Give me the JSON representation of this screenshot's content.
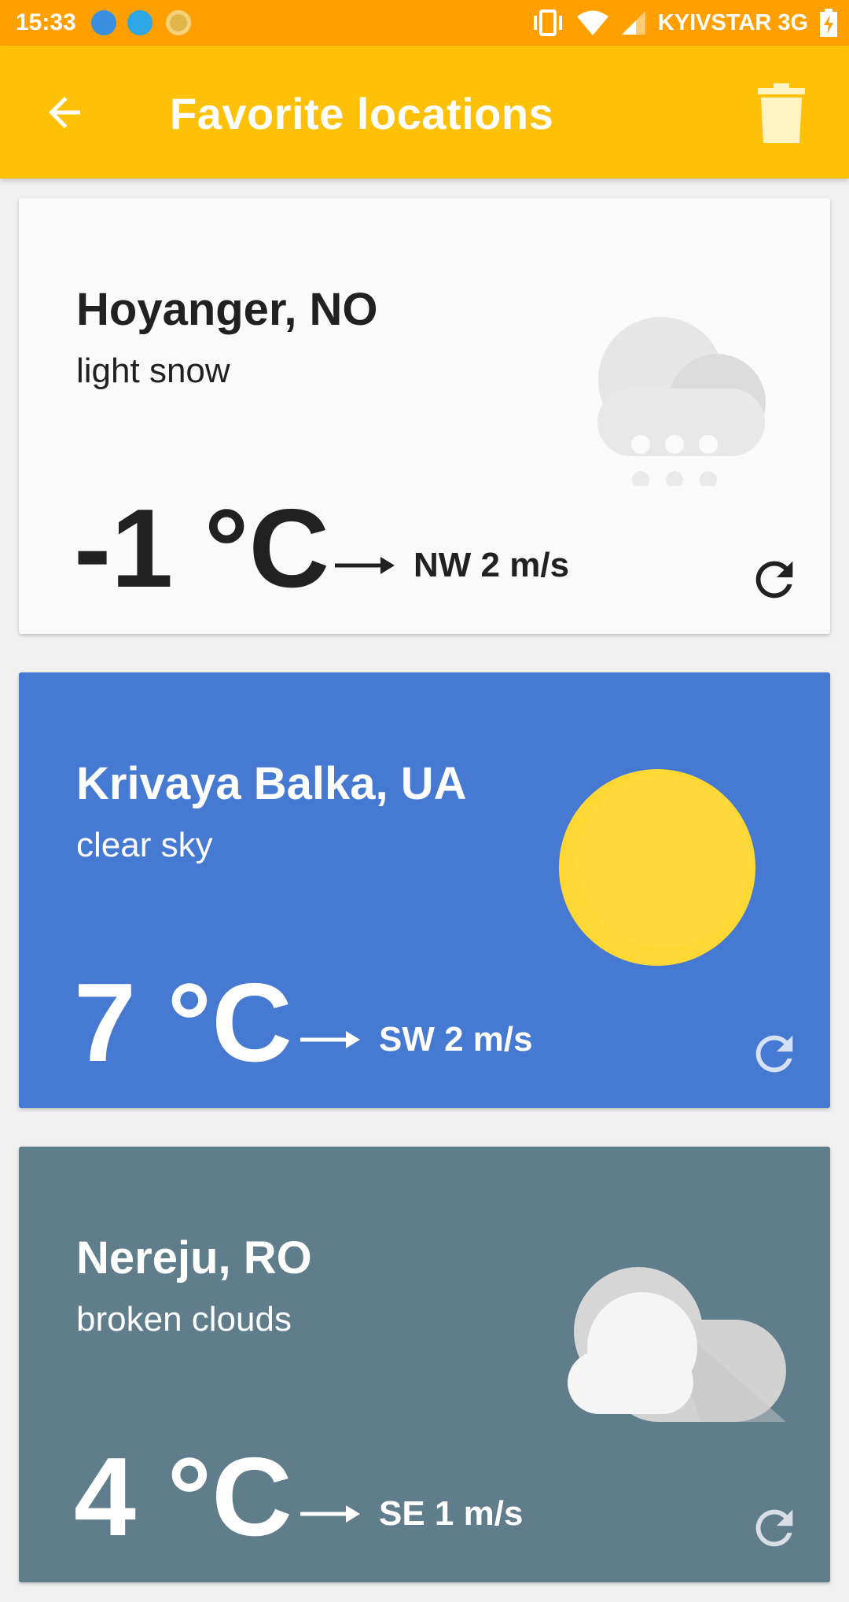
{
  "status_bar": {
    "time": "15:33",
    "carrier": "KYIVSTAR 3G",
    "background": "#FFA000"
  },
  "app_bar": {
    "title": "Favorite locations",
    "back_icon": "arrow-back-icon",
    "delete_icon": "trash-icon",
    "background": "#FFC107"
  },
  "locations": [
    {
      "city": "Hoyanger, NO",
      "description": "light snow",
      "temperature": "-1 °C",
      "wind": "NW 2 m/s",
      "icon": "snow-cloud-icon",
      "background": "#FAFAFA"
    },
    {
      "city": "Krivaya Balka, UA",
      "description": "clear sky",
      "temperature": "7 °C",
      "wind": "SW 2 m/s",
      "icon": "sun-icon",
      "background": "#4679D1"
    },
    {
      "city": "Nereju, RO",
      "description": "broken clouds",
      "temperature": "4 °C",
      "wind": "SE 1 m/s",
      "icon": "broken-clouds-icon",
      "background": "#607D8B"
    }
  ]
}
